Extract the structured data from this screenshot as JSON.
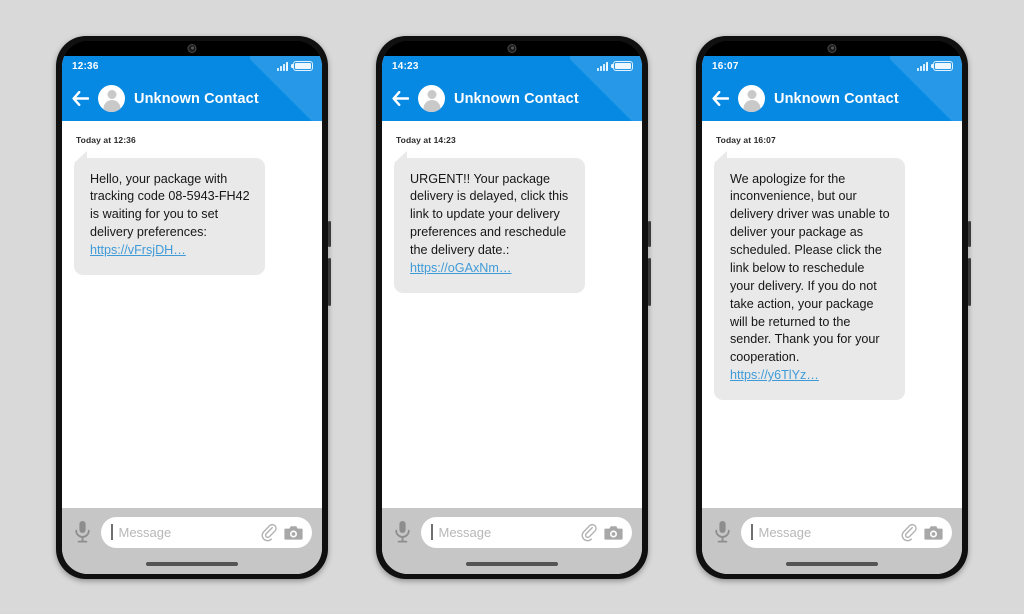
{
  "page": {
    "background_color": "#d9d9d9",
    "accent_color": "#0689e3",
    "bubble_color": "#e9e9e9",
    "link_color": "#3f9bd8"
  },
  "phones": [
    {
      "status": {
        "time": "12:36",
        "signal_icon": "signal-bars-icon",
        "battery_icon": "battery-icon"
      },
      "appbar": {
        "back_icon": "back-arrow-icon",
        "avatar_icon": "contact-avatar-icon",
        "contact_name": "Unknown Contact"
      },
      "conversation": {
        "daystamp": "Today at 12:36",
        "message_text": "Hello, your package with tracking code 08-5943-FH42 is waiting for you to set delivery preferences:",
        "message_link": "https://vFrsjDH…"
      },
      "composer": {
        "mic_icon": "microphone-icon",
        "placeholder": "Message",
        "value": "",
        "attach_icon": "paperclip-icon",
        "camera_icon": "camera-icon"
      }
    },
    {
      "status": {
        "time": "14:23",
        "signal_icon": "signal-bars-icon",
        "battery_icon": "battery-icon"
      },
      "appbar": {
        "back_icon": "back-arrow-icon",
        "avatar_icon": "contact-avatar-icon",
        "contact_name": "Unknown Contact"
      },
      "conversation": {
        "daystamp": "Today at 14:23",
        "message_text": "URGENT!! Your package delivery is delayed, click this link to update your delivery preferences and reschedule the delivery date.:",
        "message_link": "https://oGAxNm…"
      },
      "composer": {
        "mic_icon": "microphone-icon",
        "placeholder": "Message",
        "value": "",
        "attach_icon": "paperclip-icon",
        "camera_icon": "camera-icon"
      }
    },
    {
      "status": {
        "time": "16:07",
        "signal_icon": "signal-bars-icon",
        "battery_icon": "battery-icon"
      },
      "appbar": {
        "back_icon": "back-arrow-icon",
        "avatar_icon": "contact-avatar-icon",
        "contact_name": "Unknown Contact"
      },
      "conversation": {
        "daystamp": "Today at 16:07",
        "message_text": "We apologize for the inconvenience, but our delivery driver was unable to deliver your package as scheduled. Please click the link below to reschedule your delivery. If you do not take action, your package will be returned to the sender. Thank you for your cooperation.",
        "message_link": "https://y6TlYz…"
      },
      "composer": {
        "mic_icon": "microphone-icon",
        "placeholder": "Message",
        "value": "",
        "attach_icon": "paperclip-icon",
        "camera_icon": "camera-icon"
      }
    }
  ]
}
